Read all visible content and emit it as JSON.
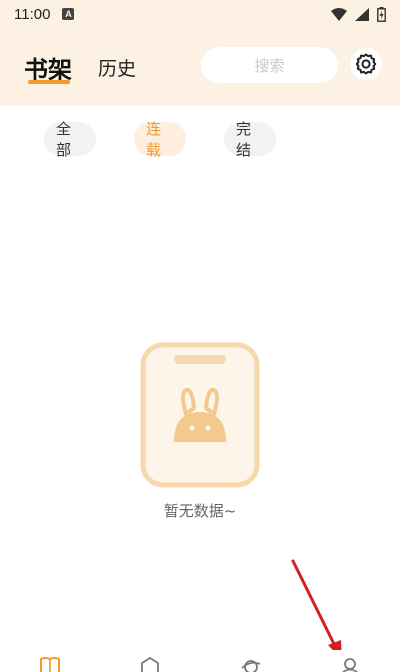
{
  "status_bar": {
    "time": "11:00",
    "notification_letter": "A",
    "icons": [
      "wifi-icon",
      "signal-icon",
      "battery-charging-icon"
    ]
  },
  "header": {
    "tabs": [
      {
        "label": "书架",
        "active": true
      },
      {
        "label": "历史",
        "active": false
      }
    ],
    "search": {
      "placeholder": "搜索"
    },
    "settings_icon": "gear-icon"
  },
  "filters": [
    {
      "label": "全部",
      "active": false
    },
    {
      "label": "连载",
      "active": true
    },
    {
      "label": "完结",
      "active": false
    }
  ],
  "empty_state": {
    "message": "暂无数据~",
    "icon": "rabbit-tablet-illustration"
  },
  "bottom_nav": {
    "items": [
      {
        "icon": "book-icon",
        "active": true
      },
      {
        "icon": "home-icon",
        "active": false
      },
      {
        "icon": "planet-icon",
        "active": false
      },
      {
        "icon": "user-icon",
        "active": false
      }
    ]
  },
  "colors": {
    "accent": "#f39a2c",
    "header_bg": "#fdf1e3",
    "chip_bg": "#f2f2f2",
    "chip_active_bg": "#fdeedd",
    "annotation_arrow": "#d21f1f"
  }
}
